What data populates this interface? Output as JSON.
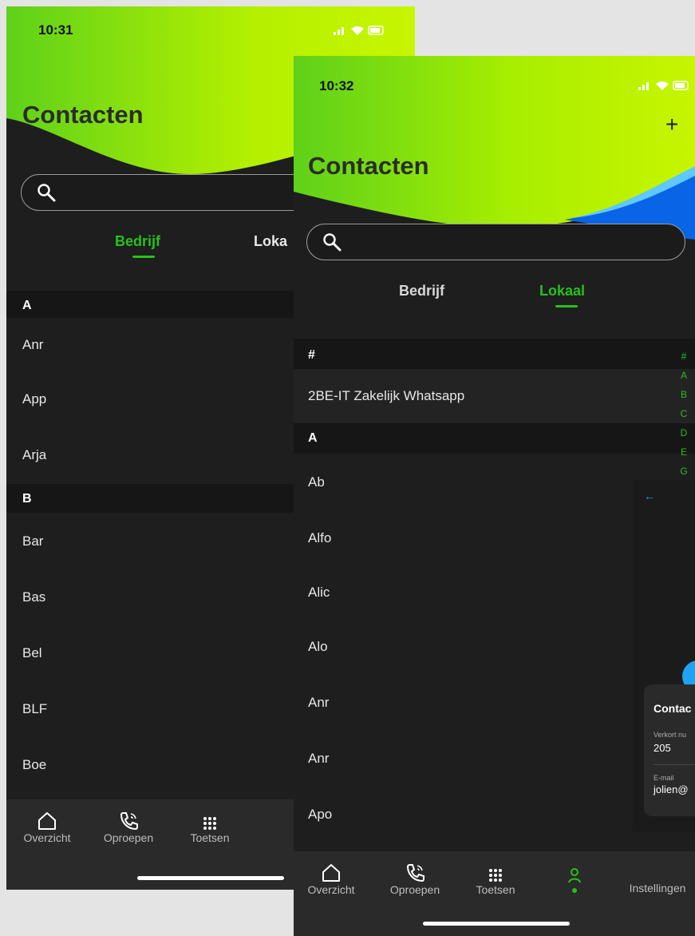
{
  "phone1": {
    "time": "10:31",
    "title": "Contacten",
    "tabs": [
      "Bedrijf",
      "Loka"
    ],
    "sections": [
      {
        "header": "A",
        "rows": [
          "Anr",
          "App",
          "Arja"
        ]
      },
      {
        "header": "B",
        "rows": [
          "Bar",
          "Bas",
          "Bel",
          "BLF",
          "Boe"
        ]
      }
    ],
    "nav": [
      "Overzicht",
      "Oproepen",
      "Toetsen"
    ]
  },
  "phone2": {
    "time": "10:32",
    "title": "Contacten",
    "add_icon": "+",
    "tabs": [
      "Bedrijf",
      "Lokaal"
    ],
    "sections": [
      {
        "header": "#",
        "rows": [
          "2BE-IT Zakelijk Whatsapp"
        ]
      },
      {
        "header": "A",
        "rows": [
          "Ab",
          "Alfo",
          "Alic",
          "Alo",
          "Anr",
          "Anr",
          "Apo"
        ]
      }
    ],
    "alpha_index": [
      "#",
      "A",
      "B",
      "C",
      "D",
      "E",
      "G"
    ],
    "nav": [
      "Overzicht",
      "Oproepen",
      "Toetsen",
      "",
      "Instellingen"
    ]
  },
  "detail": {
    "back": "←",
    "card_title": "Contac",
    "short_label": "Verkort nu",
    "short_value": "205",
    "email_label": "E-mail",
    "email_value": "jolien@"
  },
  "colors": {
    "accent": "#27c11b",
    "header_green": "#8fe000",
    "blue": "#0a64e6"
  }
}
